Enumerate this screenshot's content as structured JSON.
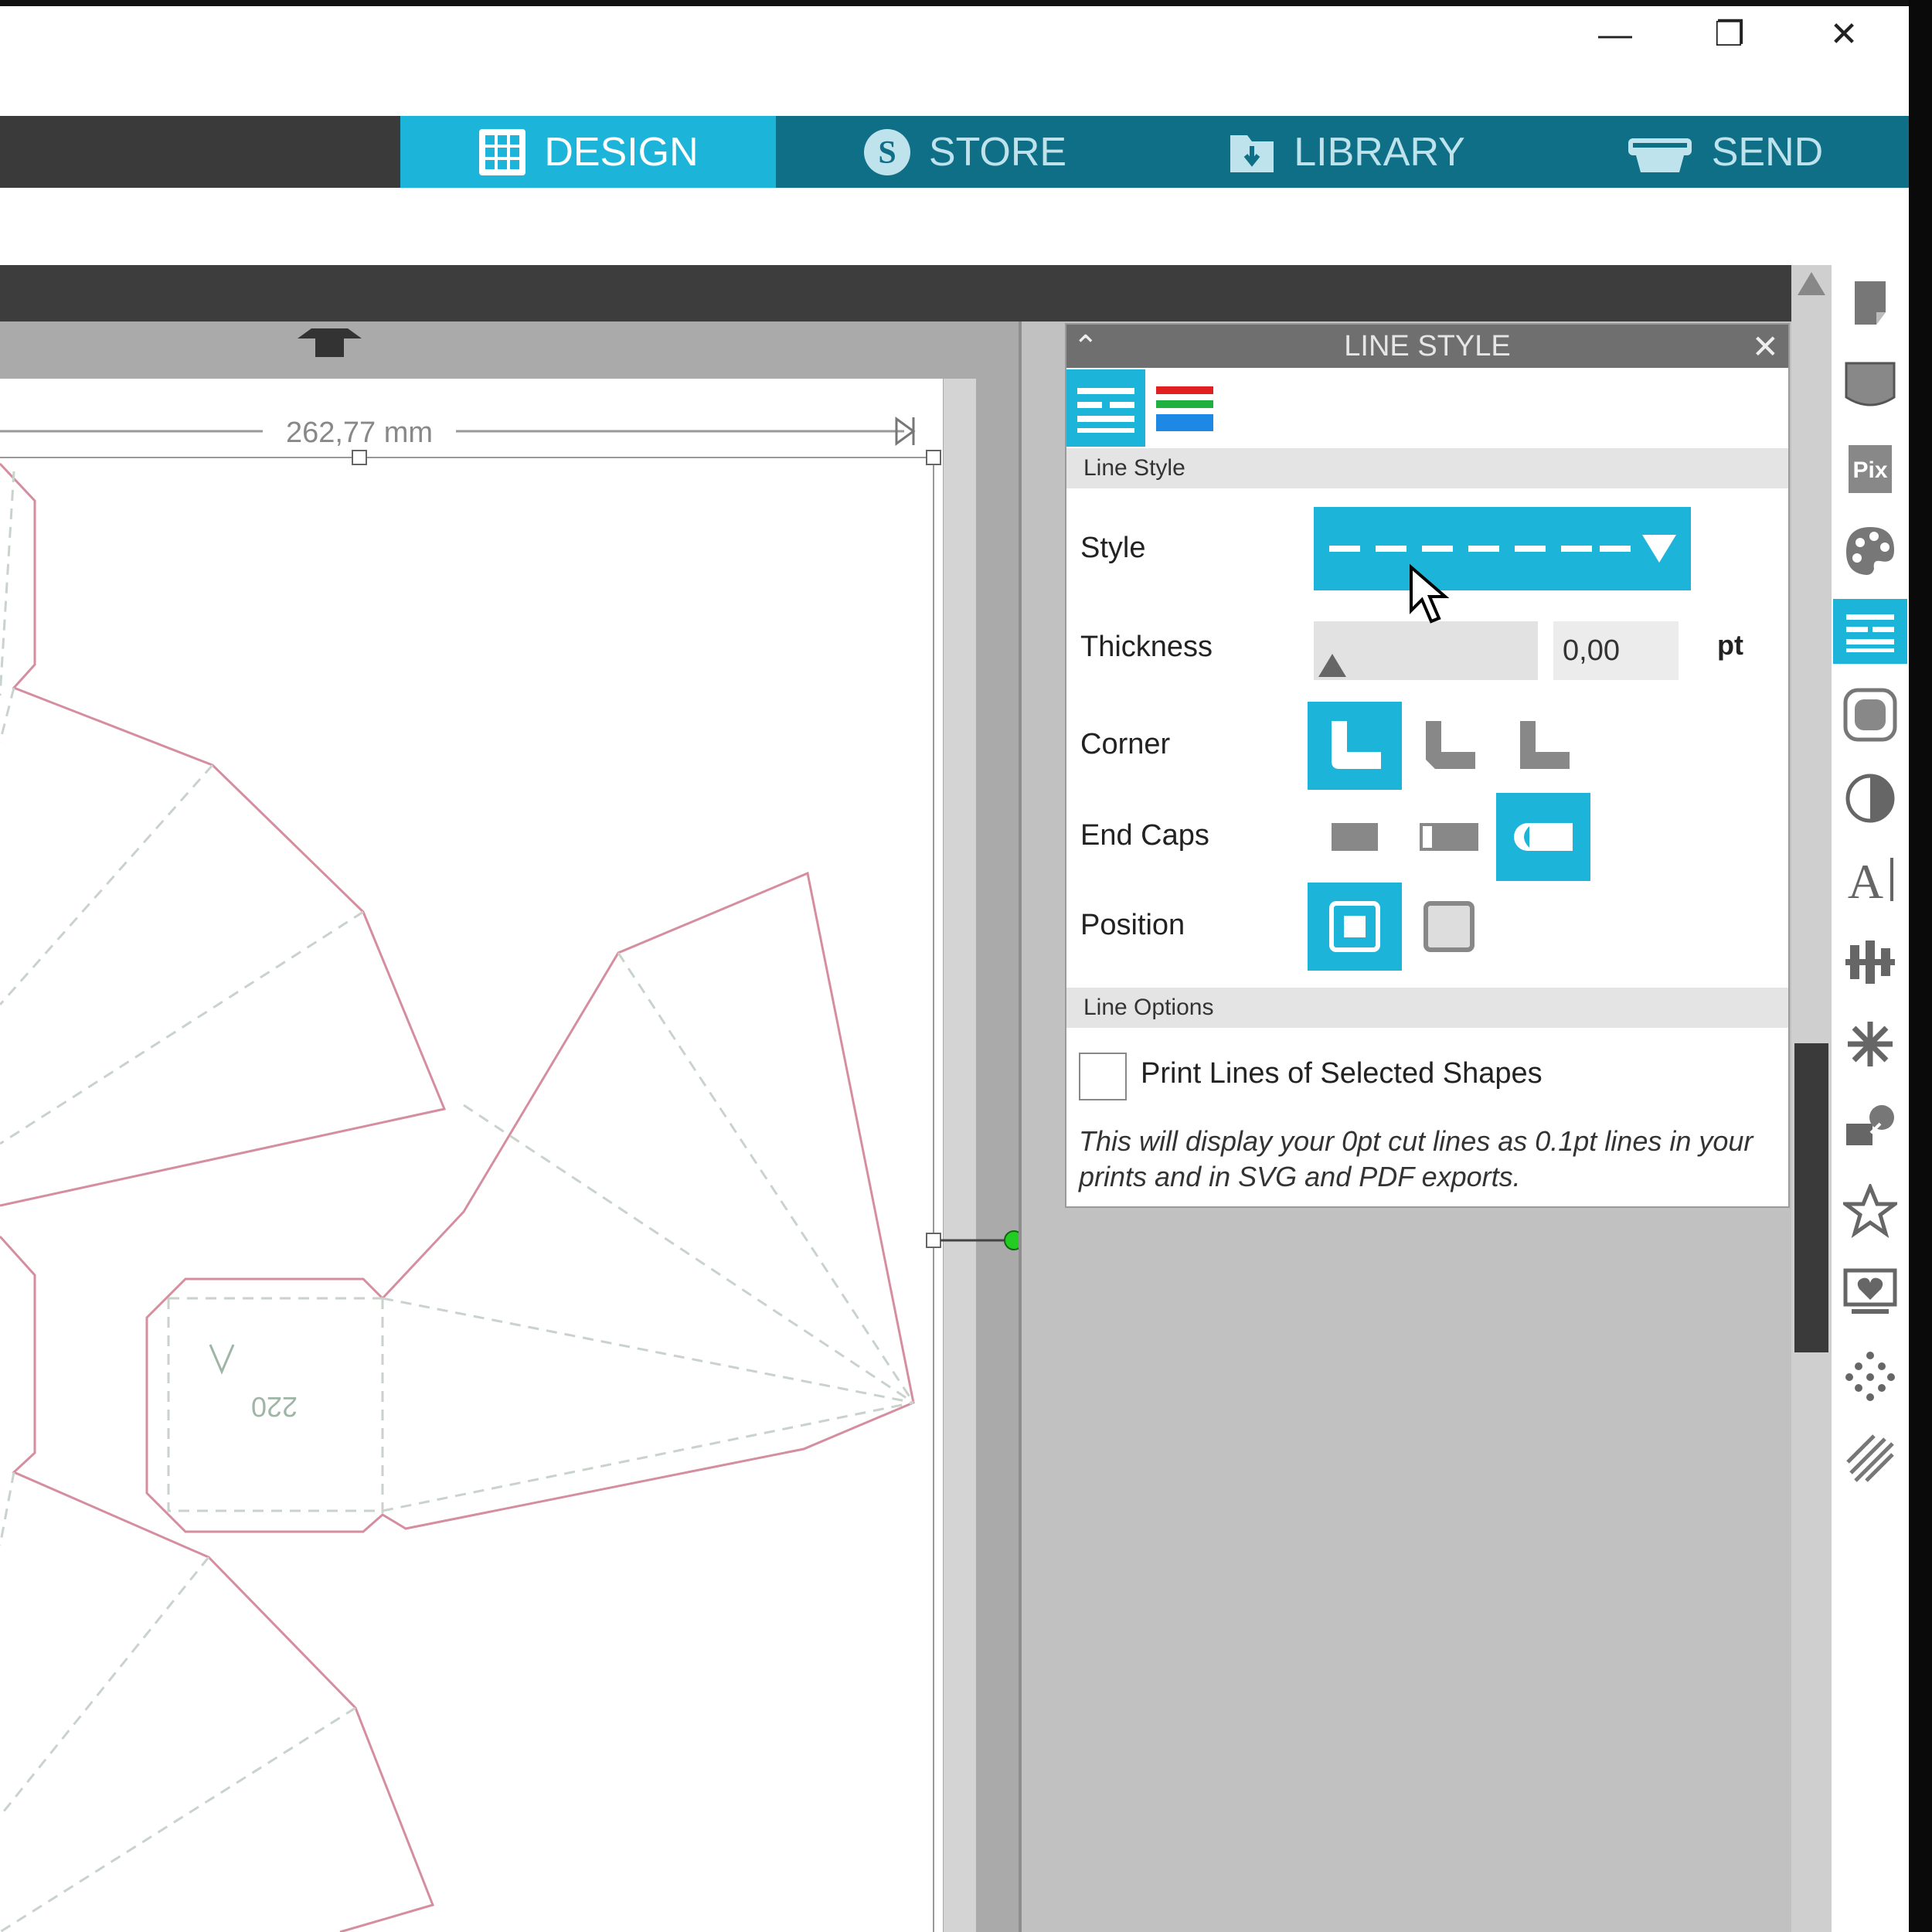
{
  "window": {
    "minimize_glyph": "—",
    "restore_glyph": "❐",
    "close_glyph": "✕"
  },
  "nav": {
    "tabs": [
      {
        "label": "DESIGN",
        "icon": "grid-icon",
        "active": true
      },
      {
        "label": "STORE",
        "icon": "store-s-icon",
        "active": false
      },
      {
        "label": "LIBRARY",
        "icon": "library-icon",
        "active": false
      },
      {
        "label": "SEND",
        "icon": "cutter-icon",
        "active": false
      }
    ]
  },
  "canvas": {
    "dimension_label": "262,77 mm",
    "shape_label": "220",
    "colors": {
      "cut_line": "#d58e9f",
      "fold_line": "#c9d3cc",
      "label": "#9fb5a6",
      "green_handle": "#22cc22"
    }
  },
  "panel": {
    "title": "LINE STYLE",
    "tabs": [
      {
        "name": "line-style-tab-icon",
        "active": true
      },
      {
        "name": "line-color-tab-icon",
        "active": false
      }
    ],
    "section_line_style": "Line Style",
    "style_label": "Style",
    "thickness_label": "Thickness",
    "thickness_value": "0,00",
    "thickness_unit": "pt",
    "corner_label": "Corner",
    "end_caps_label": "End Caps",
    "position_label": "Position",
    "section_line_options": "Line Options",
    "print_lines_label": "Print Lines of Selected Shapes",
    "print_lines_checked": false,
    "print_note": "This will display your 0pt cut lines as 0.1pt lines in your prints and in SVG and PDF exports.",
    "corner_selected": "round",
    "end_cap_selected": "round",
    "position_selected": "center"
  },
  "accent_color": "#1cb5d9",
  "right_toolbar": [
    "page-setup-icon",
    "registration-icon",
    "pixscan-icon",
    "fill-color-icon",
    "line-style-icon",
    "offset-icon",
    "image-trace-icon",
    "text-style-icon",
    "align-icon",
    "transform-icon",
    "replicate-icon",
    "modify-icon",
    "knife-icon",
    "rhinestone-icon",
    "sketch-icon"
  ]
}
